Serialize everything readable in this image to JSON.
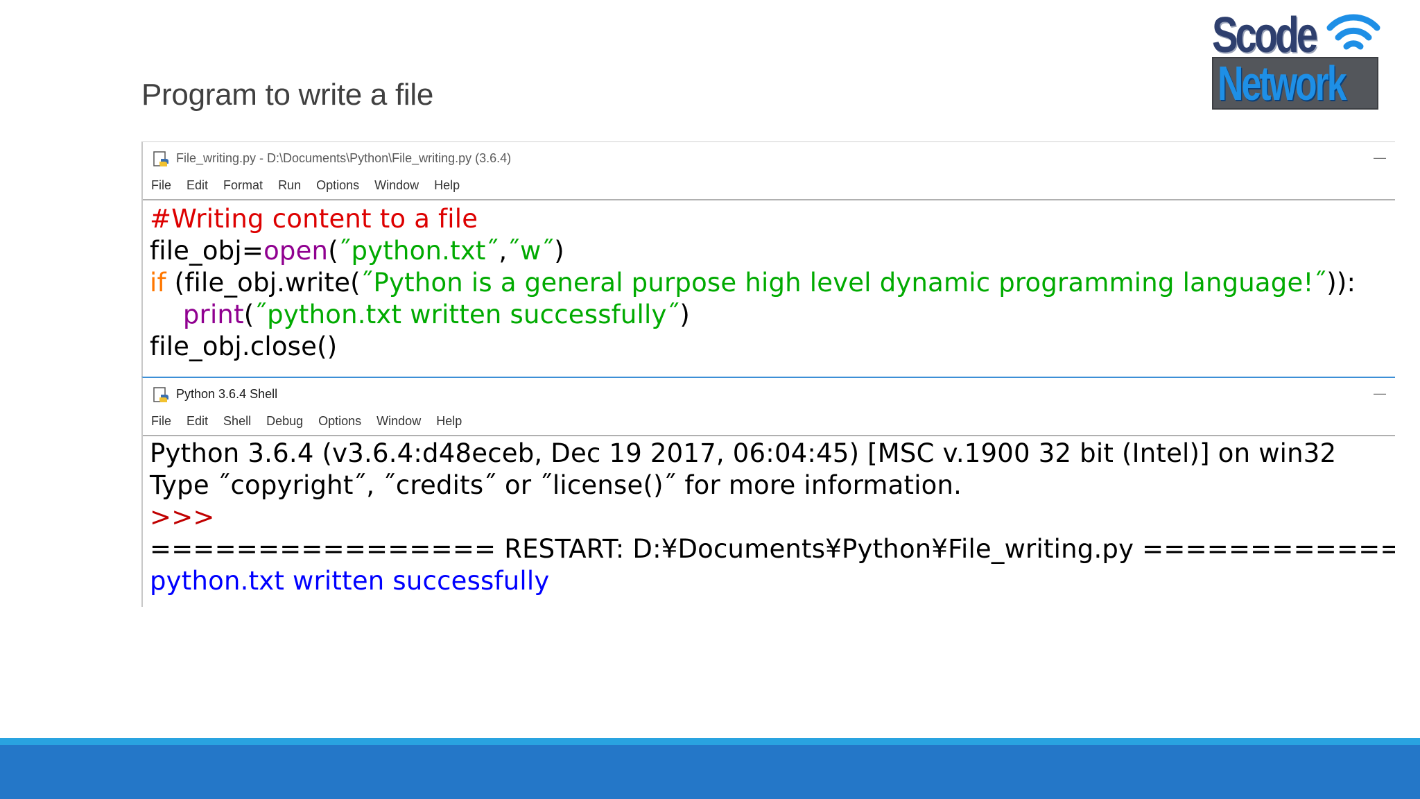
{
  "slide": {
    "title": "Program to write a file"
  },
  "logo": {
    "line1": "Scode",
    "line2": "Network"
  },
  "editor": {
    "title": "File_writing.py - D:\\Documents\\Python\\File_writing.py (3.6.4)",
    "minimize": "—",
    "menu": [
      "File",
      "Edit",
      "Format",
      "Run",
      "Options",
      "Window",
      "Help"
    ],
    "code": {
      "line1": "#Writing content to a file",
      "line2a": "file_obj=",
      "line2b": "open",
      "line2c": "(",
      "line2d": "˝python.txt˝",
      "line2e": ",",
      "line2f": "˝w˝",
      "line2g": ")",
      "line3a": "if",
      "line3b": " (file_obj.write(",
      "line3c": "˝Python is a general purpose high level dynamic programming language!˝",
      "line3d": ")):",
      "line4a": "    ",
      "line4b": "print",
      "line4c": "(",
      "line4d": "˝python.txt written successfully˝",
      "line4e": ")",
      "line5": "file_obj.close()"
    }
  },
  "shell": {
    "title": "Python 3.6.4 Shell",
    "minimize": "—",
    "menu": [
      "File",
      "Edit",
      "Shell",
      "Debug",
      "Options",
      "Window",
      "Help"
    ],
    "lines": {
      "banner": "Python 3.6.4 (v3.6.4:d48eceb, Dec 19 2017, 06:04:45) [MSC v.1900 32 bit (Intel)] on win32",
      "info": "Type ˝copyright˝, ˝credits˝ or ˝license()˝ for more information.",
      "prompt": ">>>",
      "restart": "================ RESTART: D:¥Documents¥Python¥File_writing.py ================",
      "output": "python.txt written successfully"
    }
  }
}
